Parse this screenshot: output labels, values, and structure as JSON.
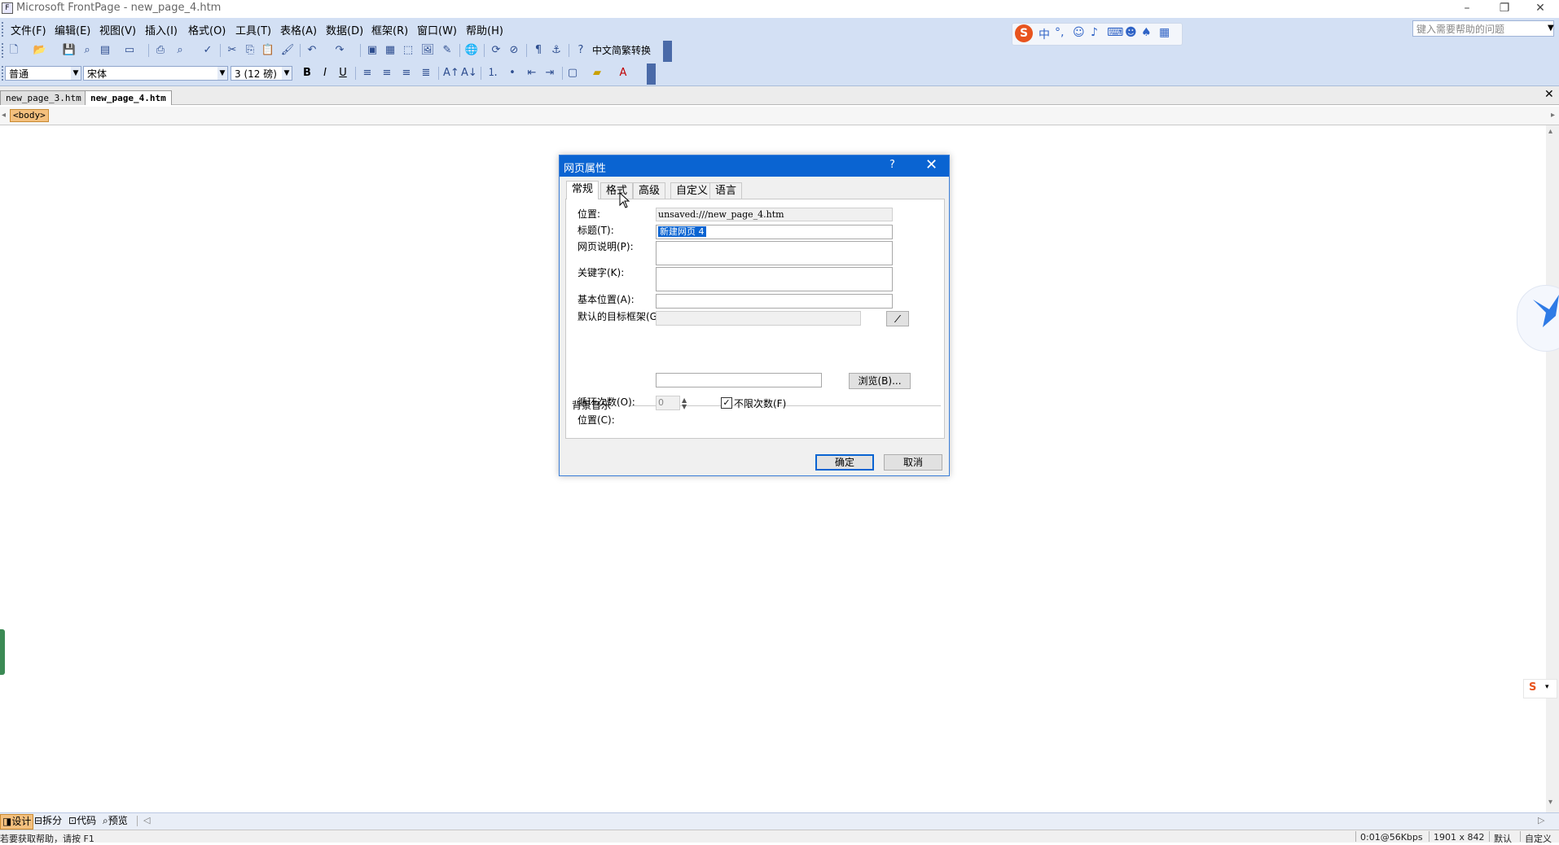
{
  "window": {
    "title": "Microsoft FrontPage - new_page_4.htm",
    "minimize": "–",
    "restore": "❐",
    "close": "✕"
  },
  "menu": [
    "文件(F)",
    "编辑(E)",
    "视图(V)",
    "插入(I)",
    "格式(O)",
    "工具(T)",
    "表格(A)",
    "数据(D)",
    "框架(R)",
    "窗口(W)",
    "帮助(H)"
  ],
  "help_box": {
    "placeholder": "键入需要帮助的问题"
  },
  "ime": {
    "mode": "中",
    "punct": "°,"
  },
  "toolbar": {
    "zh_convert": "中文简繁转换",
    "style": "普通",
    "font": "宋体",
    "size": "3 (12 磅)",
    "bold": "B",
    "italic": "I",
    "underline": "U"
  },
  "doc_tabs": [
    "new_page_3.htm",
    "new_page_4.htm"
  ],
  "quick_tag": "<body>",
  "dialog": {
    "title": "网页属性",
    "help": "?",
    "tabs": [
      "常规",
      "格式",
      "高级",
      "自定义",
      "语言"
    ],
    "fields": {
      "location_label": "位置:",
      "location_value": "unsaved:///new_page_4.htm",
      "title_label": "标题(T):",
      "title_value": "新建网页 4",
      "description_label": "网页说明(P):",
      "keywords_label": "关键字(K):",
      "base_label": "基本位置(A):",
      "target_label": "默认的目标框架(G):",
      "target_button": "⁄"
    },
    "bgsound": {
      "group_label": "背景音乐",
      "location_label": "位置(C):",
      "browse_button": "浏览(B)...",
      "loop_label": "循环次数(O):",
      "loop_value": "0",
      "forever_label": "不限次数(F)",
      "forever_checked": true
    },
    "ok": "确定",
    "cancel": "取消"
  },
  "view_buttons": [
    "设计",
    "拆分",
    "代码",
    "预览"
  ],
  "status": {
    "left": "若要获取帮助，请按 F1",
    "speed": "0:01@56Kbps",
    "size": "1901 x 842",
    "mode": "默认",
    "custom": "自定义"
  }
}
